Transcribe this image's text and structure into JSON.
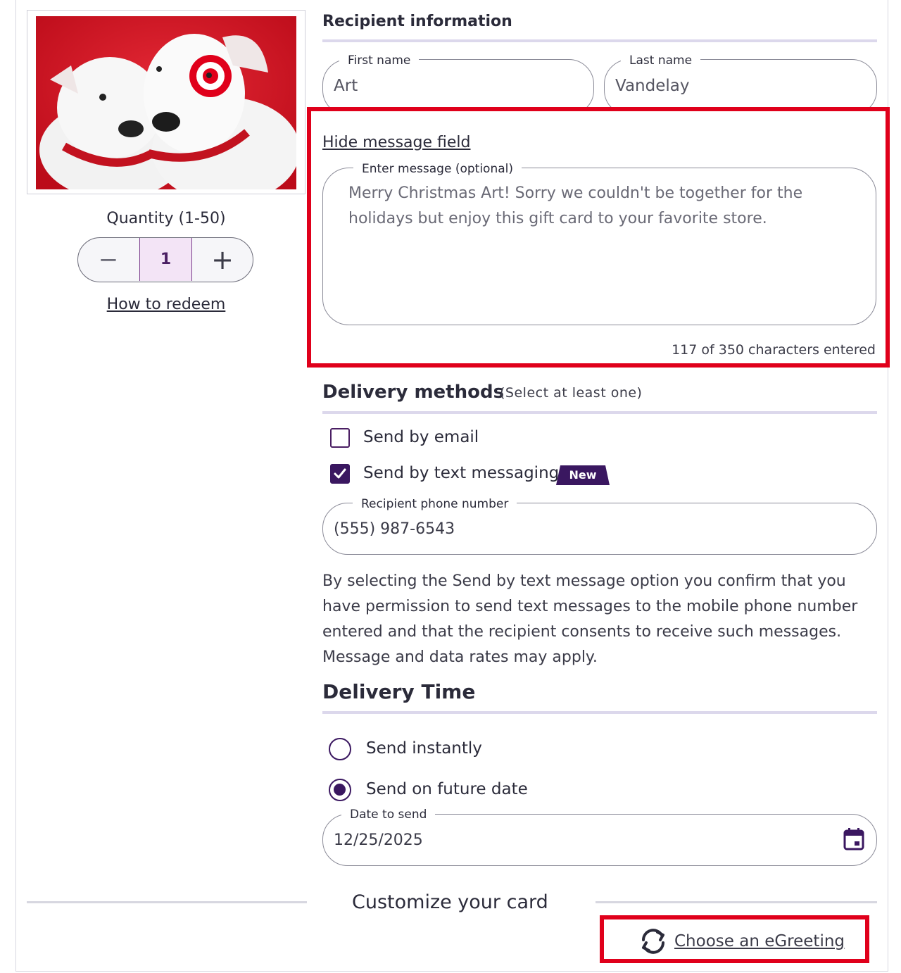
{
  "left": {
    "quantity_label": "Quantity (1-50)",
    "quantity_value": "1",
    "minus_symbol": "−",
    "plus_symbol": "+",
    "redeem_link": "How to redeem",
    "card_image_icon": "bullseye-dogs-gift-card-image"
  },
  "recipient": {
    "title": "Recipient information",
    "first_name_label": "First name",
    "first_name_value": "Art",
    "last_name_label": "Last name",
    "last_name_value": "Vandelay"
  },
  "message": {
    "toggle_link": "Hide message field",
    "label": "Enter message (optional)",
    "value": "Merry Christmas Art! Sorry we couldn't be together for the holidays but enjoy this gift card to your favorite store.",
    "counter": "117 of 350 characters entered"
  },
  "delivery": {
    "title": "Delivery methods",
    "hint": "(Select at least one)",
    "email_label": "Send by email",
    "email_checked": false,
    "text_label": "Send by text messaging",
    "text_checked": true,
    "new_badge": "New",
    "phone_label": "Recipient phone number",
    "phone_value": "(555) 987-6543",
    "disclaimer": "By selecting the Send by text message option you confirm that you have permission to send text messages to the mobile phone number entered and that the recipient consents to receive such messages. Message and data rates may apply."
  },
  "timing": {
    "title": "Delivery Time",
    "instant_label": "Send instantly",
    "instant_selected": false,
    "future_label": "Send on future date",
    "future_selected": true,
    "date_label": "Date to send",
    "date_value": "12/25/2025",
    "calendar_icon": "calendar-icon"
  },
  "customize": {
    "title": "Customize your card",
    "egreeting_link": "Choose an eGreeting",
    "egreeting_icon": "refresh-icon"
  },
  "colors": {
    "accent": "#3a1760",
    "highlight": "#e0001b",
    "rule": "#dcd8ec",
    "stepper_value_bg": "#f3e4f6"
  }
}
